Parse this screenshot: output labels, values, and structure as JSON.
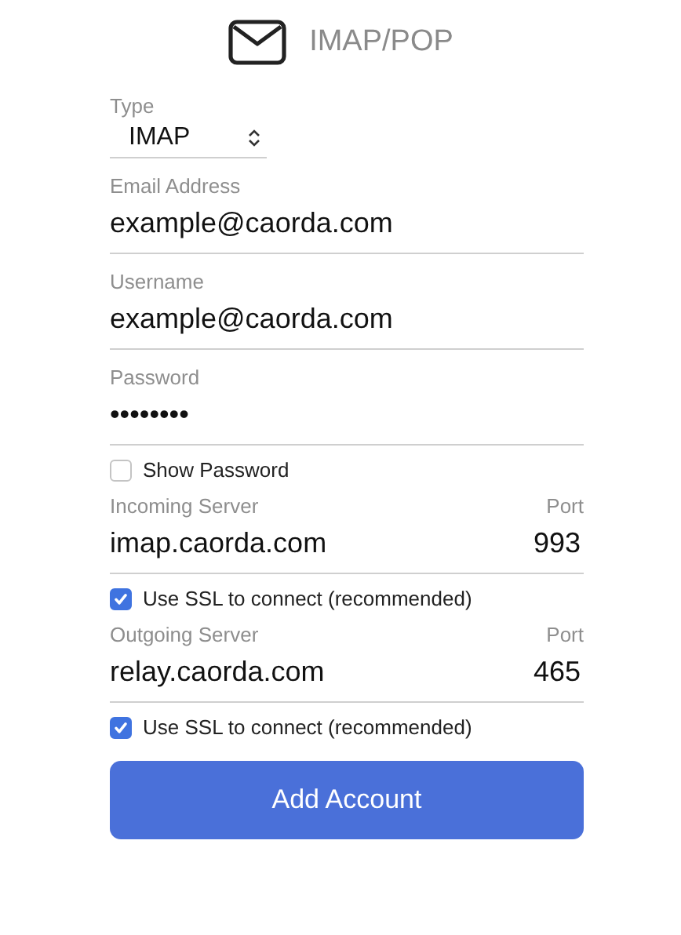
{
  "header": {
    "title": "IMAP/POP"
  },
  "type_field": {
    "label": "Type",
    "value": "IMAP"
  },
  "fields": [
    {
      "label": "Email Address",
      "value": "example@caorda.com"
    },
    {
      "label": "Username",
      "value": "example@caorda.com"
    },
    {
      "label": "Password",
      "value": "••••••••"
    }
  ],
  "show_password": {
    "label": "Show Password",
    "checked": false
  },
  "servers": [
    {
      "label": "Incoming Server",
      "port_label": "Port",
      "host": "imap.caorda.com",
      "port": "993",
      "ssl": {
        "label": "Use SSL to connect (recommended)",
        "checked": true
      }
    },
    {
      "label": "Outgoing Server",
      "port_label": "Port",
      "host": "relay.caorda.com",
      "port": "465",
      "ssl": {
        "label": "Use SSL to connect (recommended)",
        "checked": true
      }
    }
  ],
  "button": {
    "label": "Add Account"
  }
}
